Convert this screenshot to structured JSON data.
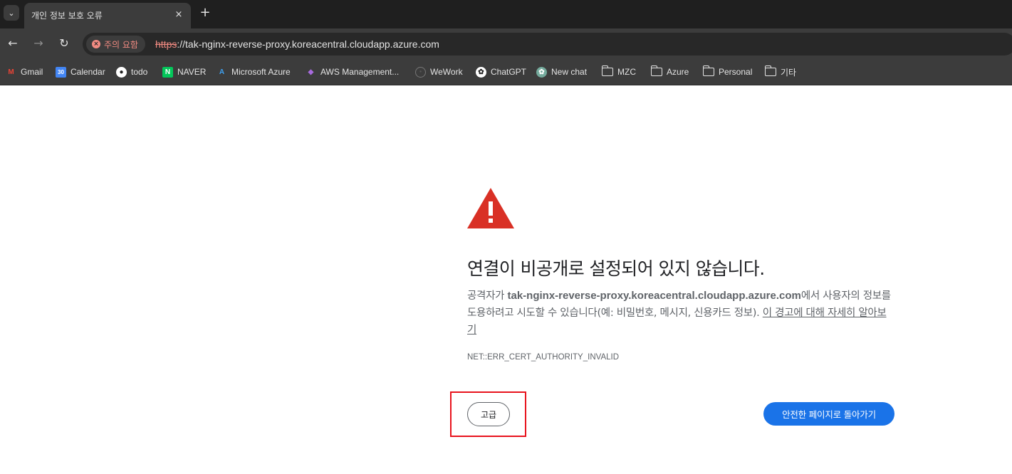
{
  "tab": {
    "title": "개인 정보 보호 오류",
    "close": "×",
    "new_tab": "+",
    "search_glyph": "⌄"
  },
  "toolbar": {
    "back_glyph": "←",
    "forward_glyph": "→",
    "reload_glyph": "↻",
    "security_chip": "주의 요함",
    "security_glyph": "×",
    "url_scheme": "https",
    "url_rest": "://tak-nginx-reverse-proxy.koreacentral.cloudapp.azure.com"
  },
  "bookmarks": [
    {
      "label": "Gmail",
      "icon": "gmail-icon",
      "glyph": "M",
      "color": "#ea4335",
      "bg": "transparent"
    },
    {
      "label": "Calendar",
      "icon": "calendar-icon",
      "glyph": "30",
      "color": "#ffffff",
      "bg": "#4285f4"
    },
    {
      "label": "todo",
      "icon": "todo-icon",
      "glyph": "●",
      "color": "#1f1f1f",
      "bg": "#ffffff"
    },
    {
      "label": "NAVER",
      "icon": "naver-icon",
      "glyph": "N",
      "color": "#ffffff",
      "bg": "#03c75a"
    },
    {
      "label": "Microsoft Azure",
      "icon": "azure-icon",
      "glyph": "A",
      "color": "#3ea1f2",
      "bg": "transparent"
    },
    {
      "label": "AWS Management...",
      "icon": "aws-icon",
      "glyph": "◆",
      "color": "#a86bde",
      "bg": "transparent"
    },
    {
      "label": "WeWork",
      "icon": "wework-icon",
      "glyph": "●",
      "color": "#555555",
      "bg": "transparent"
    },
    {
      "label": "ChatGPT",
      "icon": "chatgpt-icon",
      "glyph": "✿",
      "color": "#1f1f1f",
      "bg": "#ffffff"
    },
    {
      "label": "New chat",
      "icon": "newchat-icon",
      "glyph": "✿",
      "color": "#ffffff",
      "bg": "#74aa9c"
    },
    {
      "label": "MZC",
      "icon": "folder-icon",
      "glyph": "",
      "color": "",
      "bg": ""
    },
    {
      "label": "Azure",
      "icon": "folder-icon",
      "glyph": "",
      "color": "",
      "bg": ""
    },
    {
      "label": "Personal",
      "icon": "folder-icon",
      "glyph": "",
      "color": "",
      "bg": ""
    },
    {
      "label": "기타",
      "icon": "folder-icon",
      "glyph": "",
      "color": "",
      "bg": ""
    }
  ],
  "error_page": {
    "heading": "연결이 비공개로 설정되어 있지 않습니다.",
    "body_prefix": "공격자가 ",
    "host": "tak-nginx-reverse-proxy.koreacentral.cloudapp.azure.com",
    "body_suffix": "에서 사용자의 정보를 도용하려고 시도할 수 있습니다(예: 비밀번호, 메시지, 신용카드 정보). ",
    "learn_more": "이 경고에 대해 자세히 알아보기",
    "error_code": "NET::ERR_CERT_AUTHORITY_INVALID",
    "advanced_button": "고급",
    "back_button": "안전한 페이지로 돌아가기",
    "warning_glyph": "!"
  },
  "colors": {
    "accent_blue": "#1a73e8",
    "warning_red": "#d93025",
    "highlight_red": "#e8131d"
  }
}
